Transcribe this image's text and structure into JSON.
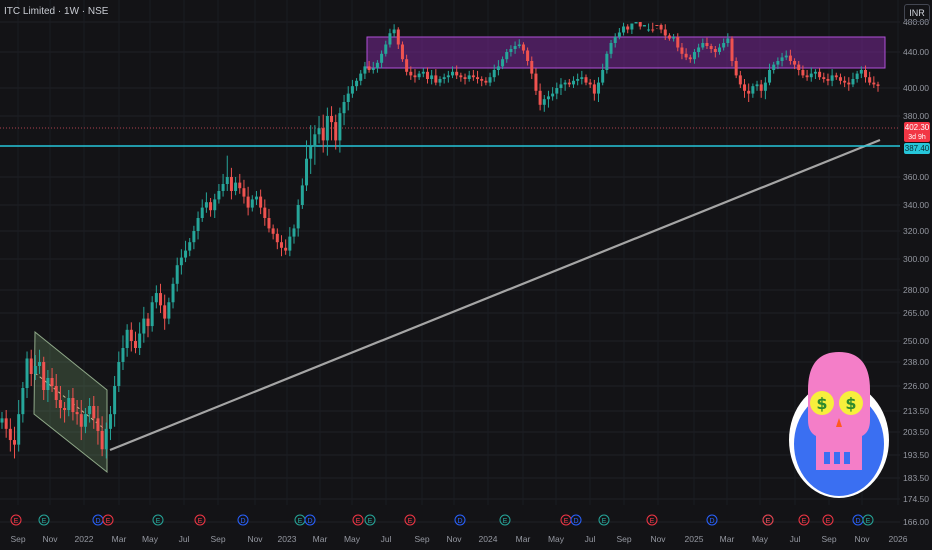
{
  "header": {
    "title": "ITC Limited · 1W · NSE",
    "currency": "INR"
  },
  "chart_data": {
    "type": "candlestick",
    "title": "ITC Limited · 1W · NSE",
    "y_ticks": [
      480.0,
      440.0,
      400.0,
      380.0,
      360.0,
      340.0,
      320.0,
      300.0,
      280.0,
      265.0,
      250.0,
      238.0,
      226.0,
      213.5,
      203.5,
      193.5,
      183.5,
      174.5,
      166.0
    ],
    "y_tick_labels": [
      "480.00",
      "440.00",
      "400.00",
      "380.00",
      "360.00",
      "340.00",
      "320.00",
      "300.00",
      "280.00",
      "265.00",
      "250.00",
      "238.00",
      "226.00",
      "213.50",
      "203.50",
      "193.50",
      "183.50",
      "174.50",
      "166.00"
    ],
    "x_labels": [
      "Sep",
      "Nov",
      "2022",
      "Mar",
      "May",
      "Jul",
      "Sep",
      "Nov",
      "2023",
      "Mar",
      "May",
      "Jul",
      "Sep",
      "Nov",
      "2024",
      "Mar",
      "May",
      "Jul",
      "Sep",
      "Nov",
      "2025",
      "Mar",
      "May",
      "Jul",
      "Sep",
      "Nov",
      "2026"
    ],
    "price_labels": {
      "last": "402.30",
      "countdown": "3d 9h",
      "support": "387.40"
    },
    "support_level": 387.4,
    "last_price": 402.3,
    "resistance_zone": [
      462,
      492
    ],
    "earnings_markers": [
      "E",
      "E",
      "D",
      "E",
      "E",
      "E",
      "D",
      "E",
      "D",
      "E",
      "E",
      "E",
      "D",
      "E",
      "E",
      "D",
      "E",
      "E",
      "D",
      "E",
      "E",
      "D",
      "E",
      "E",
      "E"
    ],
    "series": [
      {
        "values": [
          210,
          205,
          200,
          198,
          212,
          225,
          240,
          232,
          236,
          238,
          224,
          230,
          226,
          219,
          215,
          214,
          220,
          213,
          212,
          206,
          212,
          216,
          210,
          204,
          196,
          205,
          212,
          226,
          238,
          246,
          256,
          250,
          246,
          254,
          262,
          258,
          272,
          278,
          270,
          262,
          272,
          284,
          296,
          301,
          306,
          312,
          320,
          330,
          338,
          342,
          336,
          344,
          350,
          355,
          360,
          350,
          356,
          352,
          346,
          338,
          344,
          346,
          338,
          330,
          322,
          318,
          312,
          308,
          306,
          316,
          322,
          340,
          354,
          366,
          370,
          374,
          376,
          372,
          380,
          378,
          372,
          382,
          390,
          396,
          402,
          408,
          416,
          424,
          420,
          422,
          428,
          438,
          450,
          465,
          470,
          450,
          432,
          418,
          414,
          412,
          416,
          418,
          410,
          414,
          406,
          410,
          412,
          414,
          418,
          414,
          412,
          410,
          414,
          412,
          410,
          408,
          406,
          412,
          420,
          424,
          432,
          440,
          444,
          448,
          450,
          442,
          430,
          416,
          398,
          388,
          392,
          394,
          396,
          400,
          404,
          406,
          404,
          408,
          410,
          412,
          406,
          404,
          396,
          406,
          420,
          438,
          452,
          460,
          466,
          474,
          470,
          478,
          480,
          474,
          484,
          490,
          484,
          476,
          470,
          462,
          458,
          460,
          446,
          438,
          434,
          432,
          440,
          446,
          452,
          448,
          444,
          440,
          446,
          452,
          458,
          430,
          414,
          404,
          398,
          396,
          402,
          404,
          398,
          406,
          420,
          426,
          430,
          434,
          436,
          430,
          426,
          420,
          414,
          412,
          416,
          418,
          412,
          410,
          408,
          414,
          412,
          408,
          406,
          404,
          410,
          416,
          420,
          412,
          406,
          404,
          402.3
        ]
      }
    ]
  }
}
